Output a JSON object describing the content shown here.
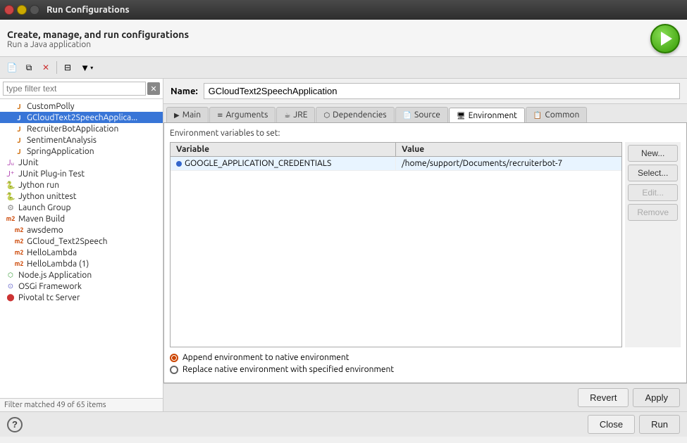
{
  "titlebar": {
    "title": "Run Configurations"
  },
  "header": {
    "heading": "Create, manage, and run configurations",
    "subheading": "Run a Java application"
  },
  "toolbar": {
    "new_label": "New",
    "duplicate_label": "Duplicate",
    "delete_label": "Delete",
    "filter_label": "Filter",
    "config_label": "Configure"
  },
  "sidebar": {
    "filter_placeholder": "type filter text",
    "items": [
      {
        "label": "CustomPolly",
        "type": "java",
        "indent": 1
      },
      {
        "label": "GCloudText2SpeechApplica...",
        "type": "java",
        "indent": 1,
        "selected": true
      },
      {
        "label": "RecruiterBotApplication",
        "type": "java",
        "indent": 1
      },
      {
        "label": "SentimentAnalysis",
        "type": "java",
        "indent": 1
      },
      {
        "label": "SpringApplication",
        "type": "java",
        "indent": 1
      },
      {
        "label": "JUnit",
        "type": "junit_group",
        "indent": 0
      },
      {
        "label": "JUnit Plug-in Test",
        "type": "junit",
        "indent": 0
      },
      {
        "label": "Jython run",
        "type": "jython",
        "indent": 0
      },
      {
        "label": "Jython unittest",
        "type": "jython",
        "indent": 0
      },
      {
        "label": "Launch Group",
        "type": "launch",
        "indent": 0
      },
      {
        "label": "Maven Build",
        "type": "maven_group",
        "indent": 0
      },
      {
        "label": "awsdemo",
        "type": "maven",
        "indent": 1
      },
      {
        "label": "GCloud_Text2Speech",
        "type": "maven",
        "indent": 1
      },
      {
        "label": "HelloLambda",
        "type": "maven",
        "indent": 1
      },
      {
        "label": "HelloLambda (1)",
        "type": "maven",
        "indent": 1
      },
      {
        "label": "Node.js Application",
        "type": "nodejs",
        "indent": 0
      },
      {
        "label": "OSGi Framework",
        "type": "osgi",
        "indent": 0
      },
      {
        "label": "Pivotal tc Server",
        "type": "tc",
        "indent": 0
      }
    ],
    "footer": "Filter matched 49 of 65 items"
  },
  "name_field": {
    "label": "Name:",
    "value": "GCloudText2SpeechApplication"
  },
  "tabs": [
    {
      "label": "Main",
      "icon": "▶",
      "active": false
    },
    {
      "label": "Arguments",
      "icon": "≡",
      "active": false
    },
    {
      "label": "JRE",
      "icon": "☕",
      "active": false
    },
    {
      "label": "Dependencies",
      "icon": "⬡",
      "active": false
    },
    {
      "label": "Source",
      "icon": "📄",
      "active": false
    },
    {
      "label": "Environment",
      "icon": "🖥",
      "active": true
    },
    {
      "label": "Common",
      "icon": "📋",
      "active": false
    }
  ],
  "environment_tab": {
    "section_label": "Environment variables to set:",
    "table": {
      "col_variable": "Variable",
      "col_value": "Value",
      "rows": [
        {
          "variable": "GOOGLE_APPLICATION_CREDENTIALS",
          "value": "/home/support/Documents/recruiterbot-7",
          "has_dot": true
        }
      ]
    },
    "buttons": {
      "new": "New...",
      "select": "Select...",
      "edit": "Edit...",
      "remove": "Remove"
    },
    "radio_options": [
      {
        "label": "Append environment to native environment",
        "checked": true
      },
      {
        "label": "Replace native environment with specified environment",
        "checked": false
      }
    ]
  },
  "bottom_panel": {
    "revert": "Revert",
    "apply": "Apply",
    "close": "Close",
    "run": "Run"
  },
  "footer": {
    "help": "?"
  }
}
